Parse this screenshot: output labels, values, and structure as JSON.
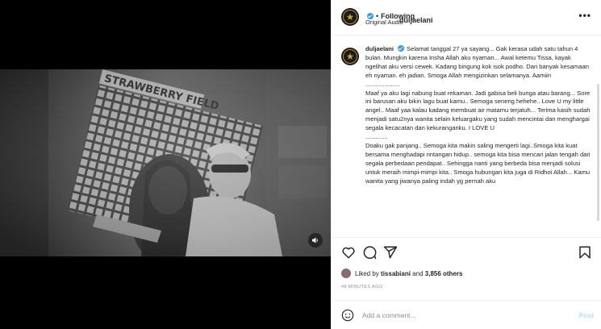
{
  "post": {
    "username": "duljaelani",
    "follow_state": "Following",
    "audio": "Original Audio",
    "more_label": "•••",
    "caption_text": "Selamat tanggal 27 ya sayang... Gak kerasa udah satu tahun 4 bulan. Mungkin karena Insha Allah aku nyaman... Awal ketemu Tissa, kayak ngelihat aku versi cewek. Kadang bingung kok isok podho. Dari banyak kesamaan eh nyaman. eh jadian. Smoga Allah mengizinkan selamanya. Aamiin\n....................\nMaaf ya aku lagi nabung buat rekaman. Jadi gabisa beli bunga atau barang... Sore ini barusan aku bikin lagu buat kamu.. Semoga seneng hehehe.. Love U my little angel.. Maaf yaa kalau kadang membuat air matamu terjatuh... Terima kasih sudah menjadi satu2nya wanita selain keluargaku yang sudah mencintai dan menghargai segala kecacatan dan kekuranganku. I LOVE U\n.............\nDoaku gak panjang.. Semoga kita makin saling mengerti lagi..Smoga kita kuat bersama menghadapi rintangan hidup.. semoga kita bisa mencari jalan tengah dari segala perbedaan pendapat.. Sehingga nanti yang berbeda bisa menjadi solusi untuk meraih mimpi-mimpi kita.. Smoga hubungan kita juga di Ridhoi Allah... Kamu wanita yang jiwanya paling indah yg pernah aku",
    "liked_prefix": "Liked by",
    "liked_user": "tissabiani",
    "liked_and": "and",
    "liked_count": "3,856 others",
    "timestamp": "48 MINUTES AGO",
    "comment_placeholder": "Add a comment...",
    "post_button": "Post",
    "photo_sign": "STRAWBERRY FIELD"
  },
  "icons": {
    "avatar": "avatar-logo-icon",
    "verified": "verified-badge-icon",
    "like": "heart-icon",
    "comment": "comment-bubble-icon",
    "share": "paper-plane-icon",
    "save": "bookmark-icon",
    "emoji": "smiley-icon",
    "mute": "speaker-icon"
  },
  "colors": {
    "link": "#0095f6",
    "post_disabled": "#b2dffc",
    "verified": "#3897f0"
  }
}
